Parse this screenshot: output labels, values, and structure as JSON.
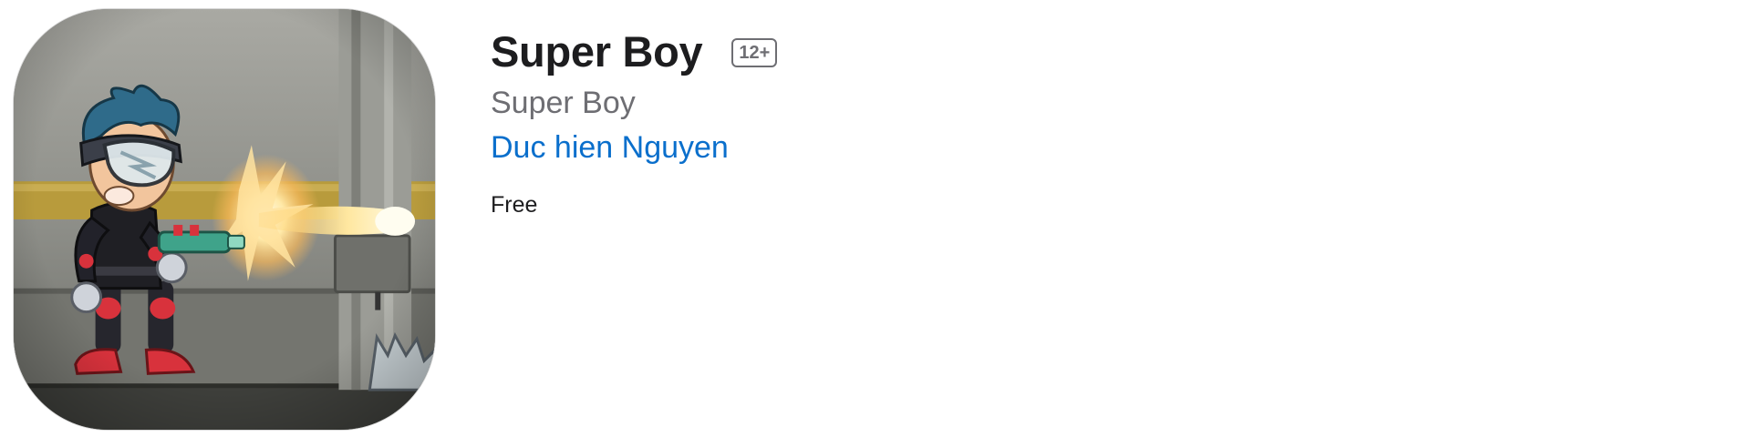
{
  "app": {
    "title": "Super Boy",
    "age_rating": "12+",
    "subtitle": "Super Boy",
    "developer": "Duc hien Nguyen",
    "price": "Free",
    "icon": "game-character-artwork"
  },
  "colors": {
    "title": "#1d1d1f",
    "secondary": "#6e6e73",
    "link": "#0a6fcc",
    "background": "#ffffff"
  }
}
